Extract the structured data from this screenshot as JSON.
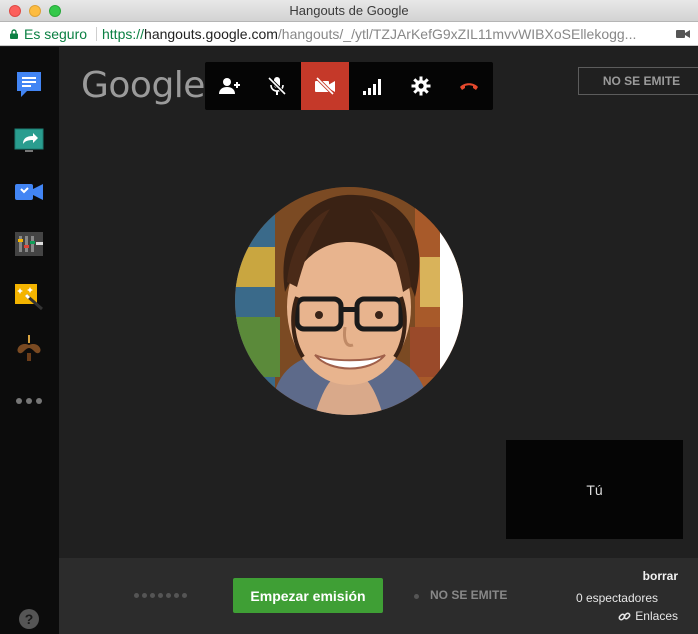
{
  "window": {
    "title": "Hangouts de Google"
  },
  "address_bar": {
    "secure_label": "Es seguro",
    "url_scheme": "https://",
    "url_host": "hangouts.google.com",
    "url_path": "/hangouts/_/ytl/TZJArKefG9xZIL11mvvWIBXoSEllekogg..."
  },
  "sidebar": {
    "apps": [
      {
        "icon": "chat-icon"
      },
      {
        "icon": "screenshare-icon"
      },
      {
        "icon": "video-control-icon"
      },
      {
        "icon": "control-room-icon"
      },
      {
        "icon": "effects-icon"
      },
      {
        "icon": "mustache-icon"
      }
    ],
    "more_icon": "more-icon",
    "help_label": "?"
  },
  "header": {
    "logo_text": "Google",
    "broadcast_status": "NO SE EMITE"
  },
  "toolbar": {
    "buttons": [
      {
        "icon": "add-person-icon"
      },
      {
        "icon": "mic-off-icon"
      },
      {
        "icon": "camera-off-icon",
        "active": true
      },
      {
        "icon": "signal-icon"
      },
      {
        "icon": "settings-icon"
      },
      {
        "icon": "hang-up-icon"
      }
    ]
  },
  "self_view": {
    "label": "Tú"
  },
  "bottom_bar": {
    "start_button_label": "Empezar emisión",
    "live_status": "NO SE EMITE",
    "event_name": "borrar",
    "viewers": "0 espectadores",
    "links_label": "Enlaces"
  },
  "colors": {
    "accent_red": "#c53929",
    "start_green": "#3f9f35",
    "secure_green": "#0b8043",
    "stage_bg": "#202020",
    "sidebar_bg": "#0c0c0c"
  }
}
